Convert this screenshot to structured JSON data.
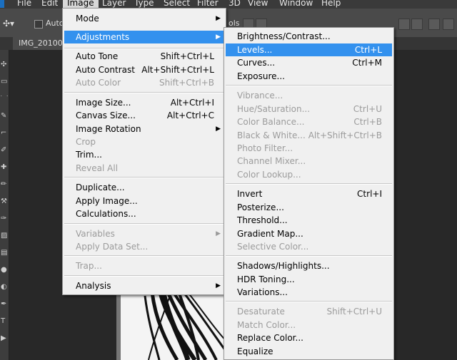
{
  "menubar": {
    "items": [
      "File",
      "Edit",
      "Image",
      "Layer",
      "Type",
      "Select",
      "Filter",
      "3D",
      "View",
      "Window",
      "Help"
    ]
  },
  "options_bar": {
    "auto_label": "Auto-",
    "partial_text": "ols"
  },
  "document_tab": {
    "title": "IMG_20100"
  },
  "image_menu": {
    "items": [
      {
        "label": "Mode",
        "submenu": true
      },
      {
        "label": "Adjustments",
        "submenu": true,
        "highlighted": true
      },
      {
        "separator": true
      },
      {
        "label": "Auto Tone",
        "shortcut": "Shift+Ctrl+L"
      },
      {
        "label": "Auto Contrast",
        "shortcut": "Alt+Shift+Ctrl+L"
      },
      {
        "label": "Auto Color",
        "shortcut": "Shift+Ctrl+B",
        "disabled": true
      },
      {
        "separator": true
      },
      {
        "label": "Image Size...",
        "shortcut": "Alt+Ctrl+I"
      },
      {
        "label": "Canvas Size...",
        "shortcut": "Alt+Ctrl+C"
      },
      {
        "label": "Image Rotation",
        "submenu": true
      },
      {
        "label": "Crop",
        "disabled": true
      },
      {
        "label": "Trim..."
      },
      {
        "label": "Reveal All",
        "disabled": true
      },
      {
        "separator": true
      },
      {
        "label": "Duplicate..."
      },
      {
        "label": "Apply Image..."
      },
      {
        "label": "Calculations..."
      },
      {
        "separator": true
      },
      {
        "label": "Variables",
        "submenu": true,
        "disabled": true
      },
      {
        "label": "Apply Data Set...",
        "disabled": true
      },
      {
        "separator": true
      },
      {
        "label": "Trap...",
        "disabled": true
      },
      {
        "separator": true
      },
      {
        "label": "Analysis",
        "submenu": true
      }
    ]
  },
  "adjustments_menu": {
    "items": [
      {
        "label": "Brightness/Contrast..."
      },
      {
        "label": "Levels...",
        "shortcut": "Ctrl+L",
        "highlighted": true
      },
      {
        "label": "Curves...",
        "shortcut": "Ctrl+M"
      },
      {
        "label": "Exposure..."
      },
      {
        "separator": true
      },
      {
        "label": "Vibrance...",
        "disabled": true
      },
      {
        "label": "Hue/Saturation...",
        "shortcut": "Ctrl+U",
        "disabled": true
      },
      {
        "label": "Color Balance...",
        "shortcut": "Ctrl+B",
        "disabled": true
      },
      {
        "label": "Black & White...",
        "shortcut": "Alt+Shift+Ctrl+B",
        "disabled": true
      },
      {
        "label": "Photo Filter...",
        "disabled": true
      },
      {
        "label": "Channel Mixer...",
        "disabled": true
      },
      {
        "label": "Color Lookup...",
        "disabled": true
      },
      {
        "separator": true
      },
      {
        "label": "Invert",
        "shortcut": "Ctrl+I"
      },
      {
        "label": "Posterize..."
      },
      {
        "label": "Threshold..."
      },
      {
        "label": "Gradient Map..."
      },
      {
        "label": "Selective Color...",
        "disabled": true
      },
      {
        "separator": true
      },
      {
        "label": "Shadows/Highlights..."
      },
      {
        "label": "HDR Toning..."
      },
      {
        "label": "Variations..."
      },
      {
        "separator": true
      },
      {
        "label": "Desaturate",
        "shortcut": "Shift+Ctrl+U",
        "disabled": true
      },
      {
        "label": "Match Color...",
        "disabled": true
      },
      {
        "label": "Replace Color..."
      },
      {
        "label": "Equalize"
      }
    ]
  },
  "colors": {
    "highlight": "#3391ee",
    "menu_bg": "#f0f0f0",
    "disabled_text": "#9b9b9b",
    "app_bg": "#282828"
  }
}
